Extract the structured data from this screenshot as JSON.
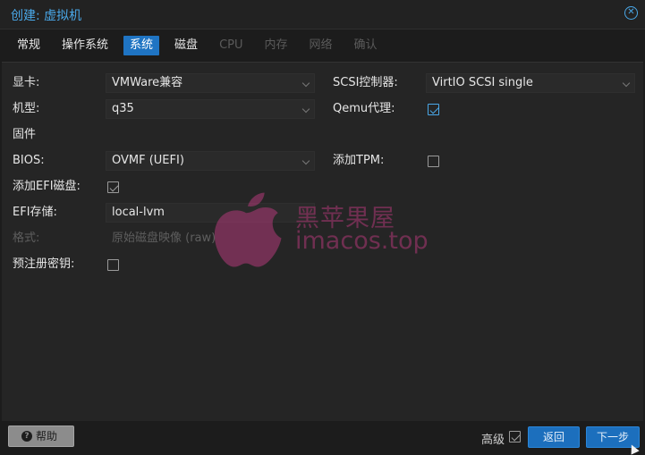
{
  "dialog": {
    "title": "创建: 虚拟机"
  },
  "tabs": [
    {
      "label": "常规",
      "state": "normal"
    },
    {
      "label": "操作系统",
      "state": "normal"
    },
    {
      "label": "系统",
      "state": "active"
    },
    {
      "label": "磁盘",
      "state": "normal"
    },
    {
      "label": "CPU",
      "state": "disabled"
    },
    {
      "label": "内存",
      "state": "disabled"
    },
    {
      "label": "网络",
      "state": "disabled"
    },
    {
      "label": "确认",
      "state": "disabled"
    }
  ],
  "form": {
    "display": {
      "label": "显卡:",
      "value": "VMWare兼容"
    },
    "machine": {
      "label": "机型:",
      "value": "q35"
    },
    "firmware_header": "固件",
    "bios": {
      "label": "BIOS:",
      "value": "OVMF (UEFI)"
    },
    "add_efi": {
      "label": "添加EFI磁盘:",
      "checked": true
    },
    "efi_storage": {
      "label": "EFI存储:",
      "value": "local-lvm"
    },
    "format": {
      "label": "格式:",
      "value": "原始磁盘映像 (raw)"
    },
    "pre_enroll": {
      "label": "预注册密钥:",
      "checked": false
    },
    "scsi_controller": {
      "label": "SCSI控制器:",
      "value": "VirtIO SCSI single"
    },
    "qemu_agent": {
      "label": "Qemu代理:",
      "checked": true
    },
    "add_tpm": {
      "label": "添加TPM:",
      "checked": false
    }
  },
  "footer": {
    "help_label": "帮助",
    "advanced_label": "高级",
    "advanced_checked": true,
    "back_label": "返回",
    "next_label": "下一步"
  },
  "watermark": {
    "cn": "黑苹果屋",
    "en": "imacos.top"
  },
  "colors": {
    "accent": "#1f74c3",
    "title": "#4aa8e8",
    "watermark": "#8a3360"
  }
}
